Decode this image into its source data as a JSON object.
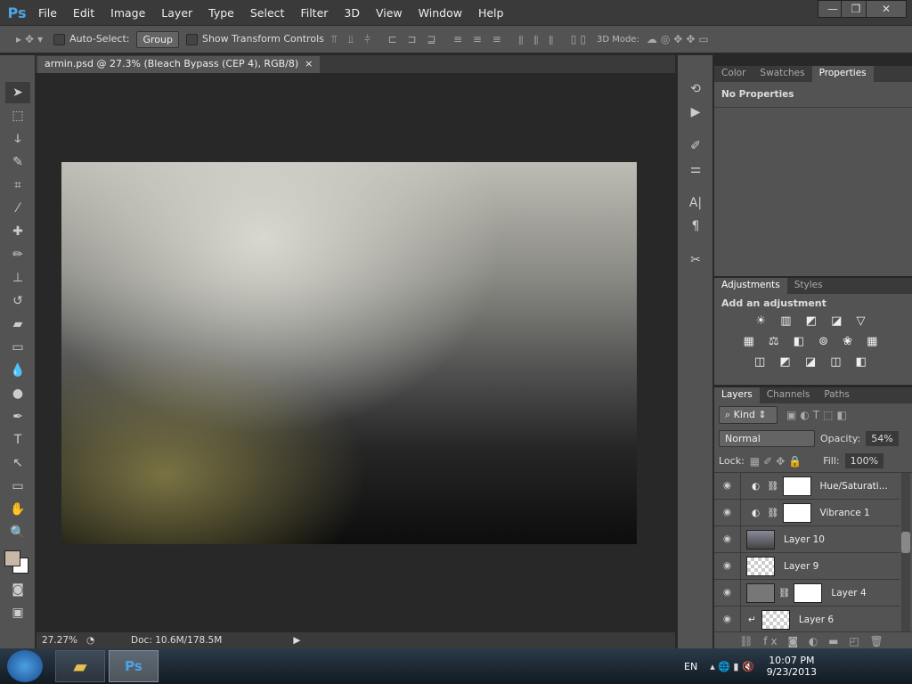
{
  "app": {
    "logo": "Ps",
    "menus": [
      "File",
      "Edit",
      "Image",
      "Layer",
      "Type",
      "Select",
      "Filter",
      "3D",
      "View",
      "Window",
      "Help"
    ],
    "window_buttons": [
      "—",
      "❐",
      "✕"
    ]
  },
  "options": {
    "auto_select": "Auto-Select:",
    "group": "Group",
    "show_transform": "Show Transform Controls",
    "mode_3d": "3D Mode:"
  },
  "document": {
    "tab_title": "armin.psd @ 27.3% (Bleach Bypass (CEP 4), RGB/8)",
    "close": "×"
  },
  "status": {
    "zoom": "27.27%",
    "doc": "Doc: 10.6M/178.5M"
  },
  "properties_panel": {
    "tabs": [
      "Color",
      "Swatches",
      "Properties"
    ],
    "active": 2,
    "content": "No Properties"
  },
  "adjustments_panel": {
    "tabs": [
      "Adjustments",
      "Styles"
    ],
    "active": 0,
    "title": "Add an adjustment",
    "rows": [
      "☀ ▥ ◩ ◪ ▽",
      "▦ ⚖ ◧ ⊚ ❀ ▦",
      "◫ ◩ ◪ ◫ ◧"
    ]
  },
  "layers_panel": {
    "tabs": [
      "Layers",
      "Channels",
      "Paths"
    ],
    "active": 0,
    "filter": "Kind",
    "blend_mode": "Normal",
    "opacity_label": "Opacity:",
    "opacity": "54%",
    "lock_label": "Lock:",
    "fill_label": "Fill:",
    "fill": "100%",
    "layers": [
      {
        "name": "Hue/Saturati...",
        "type": "adjustment"
      },
      {
        "name": "Vibrance 1",
        "type": "adjustment"
      },
      {
        "name": "Layer 10",
        "type": "image"
      },
      {
        "name": "Layer 9",
        "type": "transparent"
      },
      {
        "name": "Layer 4",
        "type": "masked"
      },
      {
        "name": "Layer 6",
        "type": "clipped"
      }
    ]
  },
  "taskbar": {
    "lang": "EN",
    "time": "10:07 PM",
    "date": "9/23/2013"
  }
}
